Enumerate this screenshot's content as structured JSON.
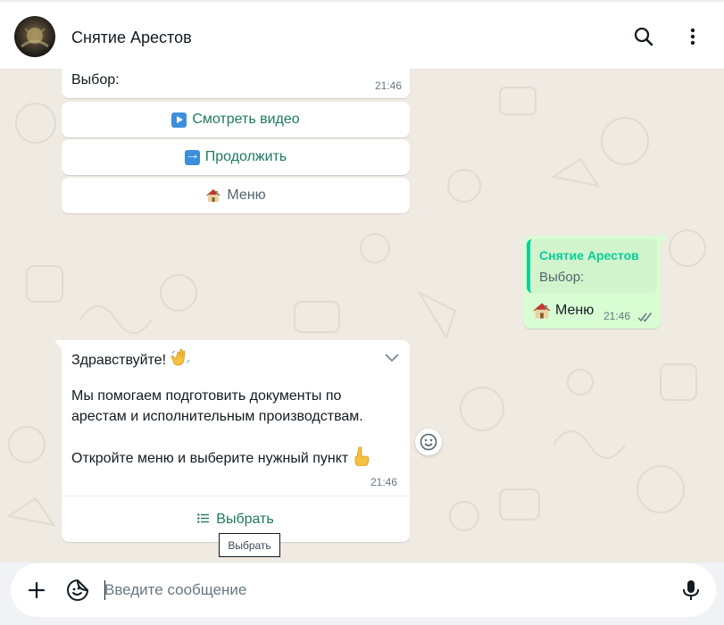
{
  "header": {
    "title": "Снятие Арестов",
    "icons": [
      "avatar",
      "search-icon",
      "menu-dots-icon"
    ]
  },
  "messages": {
    "top_bubble": {
      "text": "Выбор:",
      "time": "21:46"
    },
    "buttons": [
      {
        "icon": "play-icon",
        "label": "Смотреть видео"
      },
      {
        "icon": "arrow-right-icon",
        "label": "Продолжить"
      },
      {
        "icon": "house-icon",
        "label": "Меню"
      }
    ],
    "outgoing": {
      "quote_name": "Снятие Арестов",
      "quote_text": "Выбор:",
      "text": "Меню",
      "time": "21:46",
      "status": "read-double-check"
    },
    "main": {
      "greeting": "Здравствуйте!",
      "line1": "Мы помогаем подготовить документы по",
      "line2": "арестам и исполнительным производствам.",
      "line3": "Откройте меню и выберите нужный пункт",
      "time": "21:46",
      "action_label": "Выбрать"
    },
    "tooltip": "Выбрать"
  },
  "composer": {
    "placeholder": "Введите сообщение"
  },
  "colors": {
    "wallpaper": "#efeae2",
    "outgoing_bubble": "#d9fdd3",
    "accent_green": "#1d7a5e",
    "quote_green": "#06cf9c"
  }
}
